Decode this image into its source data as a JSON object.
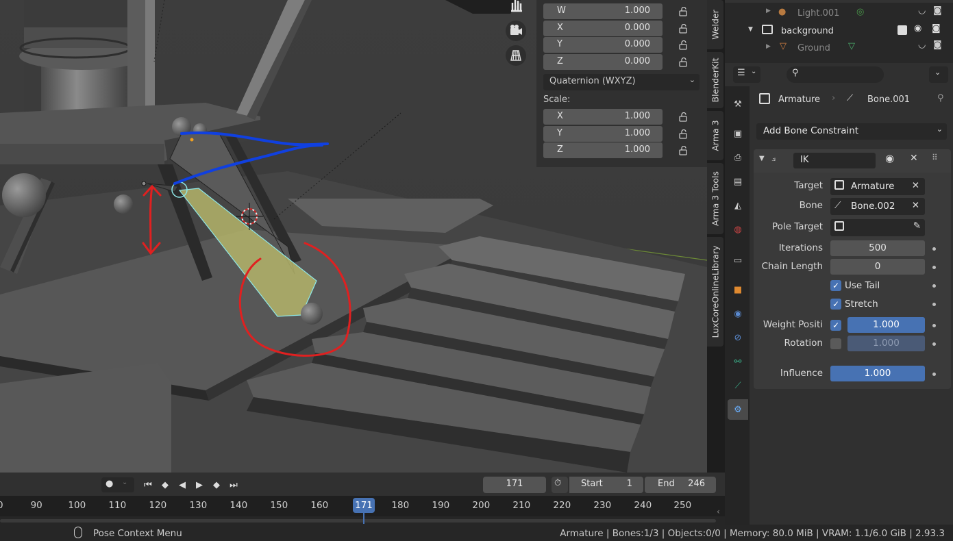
{
  "transform_panel": {
    "rotation_rows": [
      {
        "axis": "W",
        "value": "1.000"
      },
      {
        "axis": "X",
        "value": "0.000"
      },
      {
        "axis": "Y",
        "value": "0.000"
      },
      {
        "axis": "Z",
        "value": "0.000"
      }
    ],
    "rotation_mode": "Quaternion (WXYZ)",
    "scale_label": "Scale:",
    "scale_rows": [
      {
        "axis": "X",
        "value": "1.000"
      },
      {
        "axis": "Y",
        "value": "1.000"
      },
      {
        "axis": "Z",
        "value": "1.000"
      }
    ]
  },
  "side_tabs": [
    "Welder",
    "BlenderKit",
    "Arma 3",
    "Arma 3 Tools",
    "LuxCoreOnlineLibrary"
  ],
  "outliner": {
    "items": [
      {
        "label": "Light.001",
        "dimmed": true
      },
      {
        "label": "background",
        "dimmed": false
      },
      {
        "label": "Ground",
        "dimmed": true
      }
    ]
  },
  "properties": {
    "breadcrumb_object": "Armature",
    "breadcrumb_bone": "Bone.001",
    "add_constraint_label": "Add Bone Constraint",
    "constraint_name": "IK",
    "target_label": "Target",
    "target_value": "Armature",
    "bone_label": "Bone",
    "bone_value": "Bone.002",
    "pole_target_label": "Pole Target",
    "iterations_label": "Iterations",
    "iterations_value": "500",
    "chain_length_label": "Chain Length",
    "chain_length_value": "0",
    "use_tail_label": "Use Tail",
    "use_tail_checked": true,
    "stretch_label": "Stretch",
    "stretch_checked": true,
    "weight_position_label": "Weight Positi",
    "weight_position_value": "1.000",
    "weight_position_checked": true,
    "rotation_label": "Rotation",
    "rotation_value": "1.000",
    "rotation_checked": false,
    "influence_label": "Influence",
    "influence_value": "1.000"
  },
  "timeline": {
    "current_frame": "171",
    "start_label": "Start",
    "start_value": "1",
    "end_label": "End",
    "end_value": "246",
    "ruler": [
      "0",
      "90",
      "100",
      "110",
      "120",
      "130",
      "140",
      "150",
      "160",
      "171",
      "180",
      "190",
      "200",
      "210",
      "220",
      "230",
      "240",
      "250"
    ]
  },
  "status_bar": {
    "context_menu_label": "Pose Context Menu",
    "stats": "Armature | Bones:1/3 | Objects:0/0 | Memory: 80.0 MiB | VRAM: 1.1/6.0 GiB | 2.93.3"
  },
  "colors": {
    "accent_blue": "#4772b3",
    "annotation_red": "#e02020",
    "annotation_blue": "#1040e0",
    "bone_selected": "#c8c87a"
  }
}
